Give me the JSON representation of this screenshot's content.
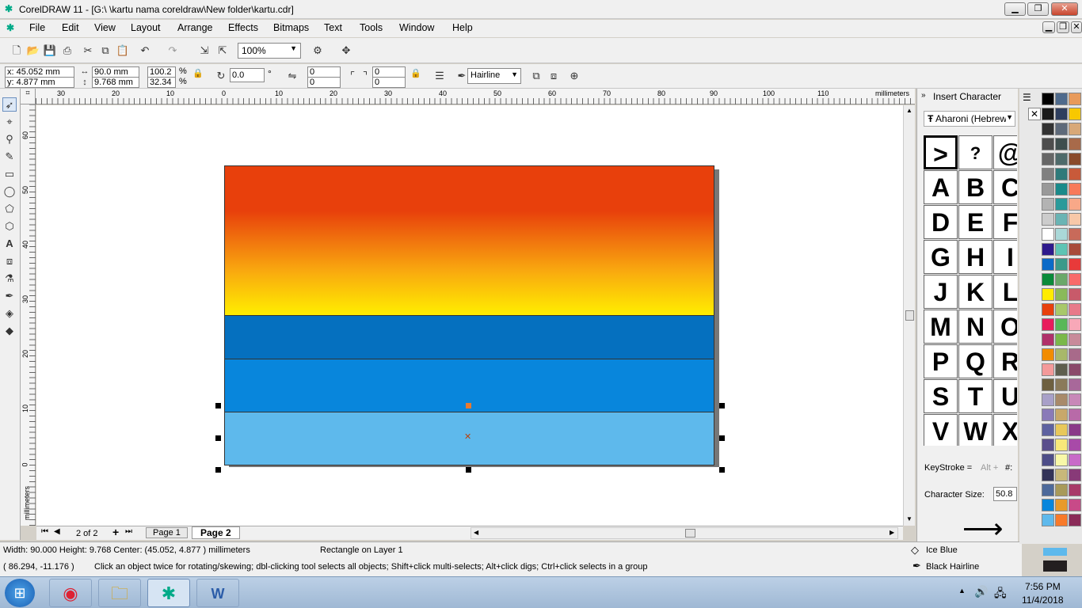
{
  "window": {
    "title": "CorelDRAW 11 - [G:\\ \\kartu nama coreldraw\\New folder\\kartu.cdr]",
    "min": "▁",
    "max": "❐",
    "close": "✕"
  },
  "menu": [
    "File",
    "Edit",
    "View",
    "Layout",
    "Arrange",
    "Effects",
    "Bitmaps",
    "Text",
    "Tools",
    "Window",
    "Help"
  ],
  "toolbar": {
    "zoom": "100%"
  },
  "propbar": {
    "x": "x:  45.052 mm",
    "y": "y:  4.877 mm",
    "width": "90.0 mm",
    "height": "9.768 mm",
    "scale_x": "100.2",
    "scale_y": "32.34",
    "pct": "%",
    "angle": "0.0",
    "deg": "°",
    "corner_tl": "0",
    "corner_bl": "0",
    "corner_tr": "0",
    "corner_br": "0",
    "outline": "Hairline"
  },
  "ruler": {
    "top_ticks": [
      "30",
      "20",
      "10",
      "0",
      "10",
      "20",
      "30",
      "40",
      "50",
      "60",
      "70",
      "80",
      "90",
      "100",
      "110"
    ],
    "unit": "millimeters",
    "left_ticks": [
      "60",
      "50",
      "40",
      "30",
      "20",
      "10",
      "0"
    ],
    "left_unit": "millimeters"
  },
  "pages": {
    "count": "2 of 2",
    "tab1": "Page 1",
    "tab2": "Page 2"
  },
  "status": {
    "dims": "Width: 90.000  Height: 9.768   Center: (45.052, 4.877 )   millimeters",
    "object": "Rectangle on Layer 1",
    "coords": "( 86.294, -11.176 )",
    "hint": "Click an object twice for rotating/skewing; dbl-clicking tool selects all objects; Shift+click multi-selects; Alt+click digs; Ctrl+click selects in a group",
    "fill": "Ice Blue",
    "outline": "Black  Hairline",
    "fill_color": "#5eb9ec",
    "outline_color": "#231f20"
  },
  "docker": {
    "title": "Insert Character",
    "font": "Aharoni (Hebrew",
    "chars": [
      ">",
      "?",
      "@",
      "A",
      "B",
      "C",
      "D",
      "E",
      "F",
      "G",
      "H",
      "I",
      "J",
      "K",
      "L",
      "M",
      "N",
      "O",
      "P",
      "Q",
      "R",
      "S",
      "T",
      "U",
      "V",
      "W",
      "X"
    ],
    "keystroke_label": "KeyStroke =",
    "keystroke_hint": "Alt +",
    "hash": "#:",
    "size_label": "Character Size:",
    "size_value": "50.8"
  },
  "taskbar": {
    "time": "7:56 PM",
    "date": "11/4/2018"
  },
  "colors": {
    "grad_top": "#e8400c",
    "grad_bottom": "#ffee00",
    "band1": "#0570bf",
    "band2": "#0886dc",
    "band3": "#5eb9ec"
  }
}
